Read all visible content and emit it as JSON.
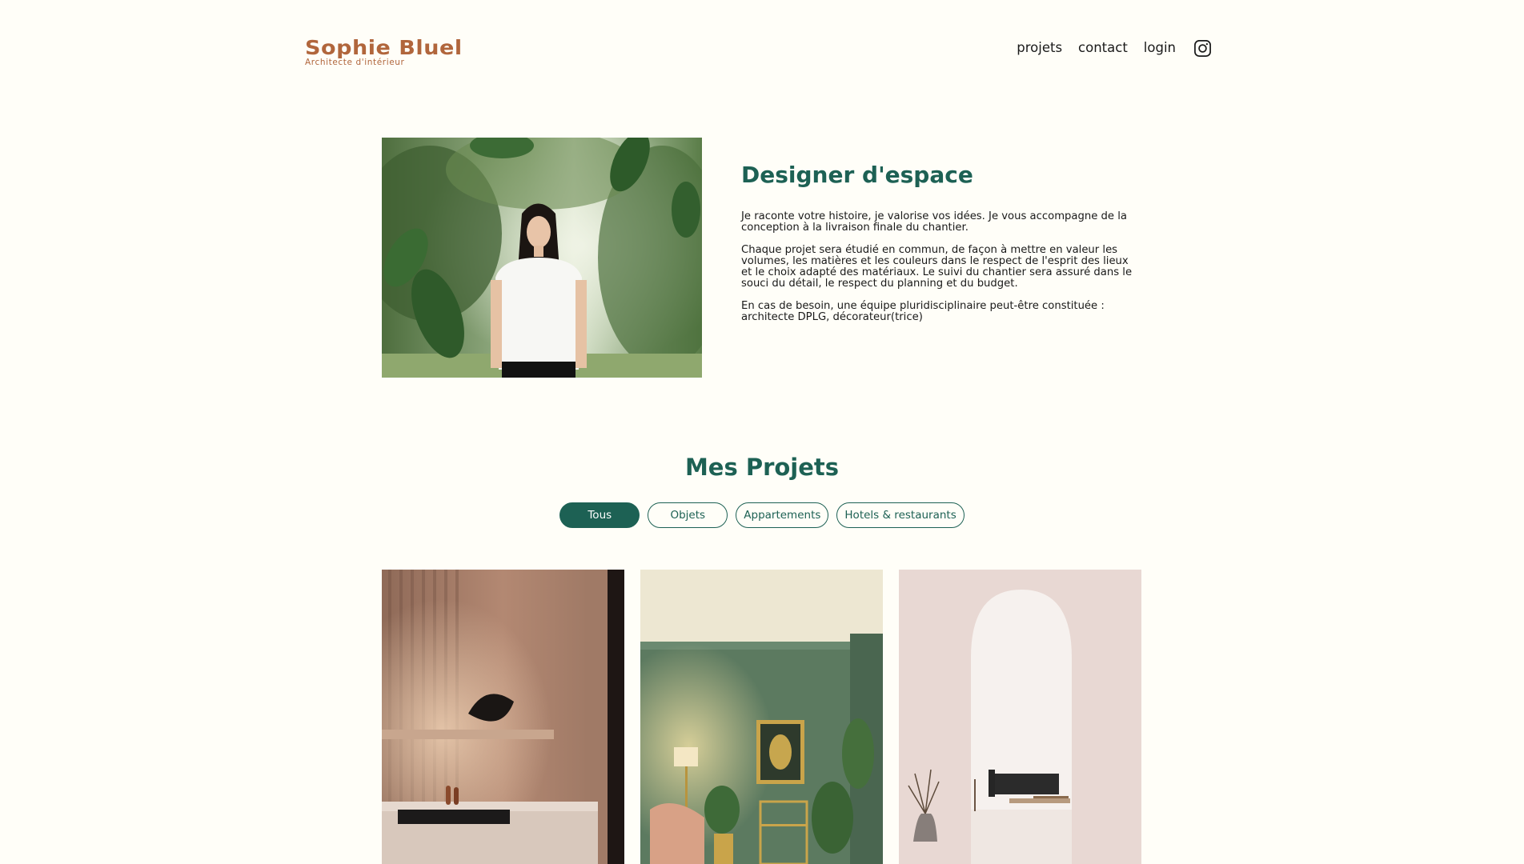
{
  "brand": {
    "name": "Sophie Bluel",
    "subtitle": "Architecte d'intérieur"
  },
  "nav": {
    "items": [
      "projets",
      "contact",
      "login"
    ],
    "social_icon": "instagram-icon"
  },
  "intro": {
    "title": "Designer d'espace",
    "paragraphs": [
      "Je raconte votre histoire, je valorise vos idées. Je vous accompagne de la conception à la livraison finale du chantier.",
      "Chaque projet sera étudié en commun, de façon à mettre en valeur les volumes, les matières et les couleurs dans le respect de l'esprit des lieux et le choix adapté des matériaux. Le suivi du chantier sera assuré dans le souci du détail, le respect du planning et du budget.",
      "En cas de besoin, une équipe pluridisciplinaire peut-être constituée : architecte DPLG, décorateur(trice)"
    ]
  },
  "projects": {
    "title": "Mes Projets",
    "filters": [
      "Tous",
      "Objets",
      "Appartements",
      "Hotels & restaurants"
    ],
    "active_filter": "Tous"
  },
  "colors": {
    "background": "#FFFEF8",
    "brand": "#B1663C",
    "accent": "#1D6154"
  }
}
